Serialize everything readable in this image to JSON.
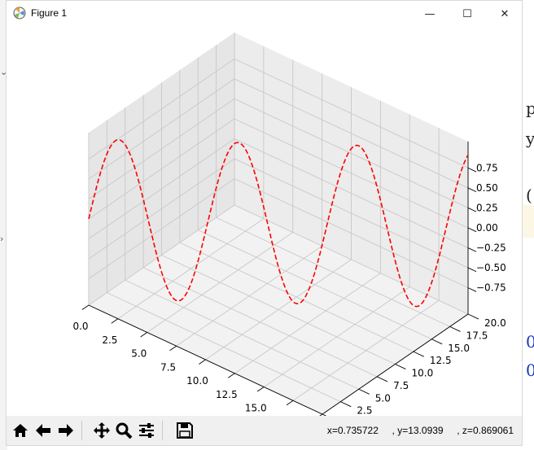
{
  "window": {
    "title": "Figure 1",
    "minimize_glyph": "—",
    "maximize_glyph": "☐",
    "close_glyph": "✕"
  },
  "toolbar": {
    "buttons": [
      {
        "name": "home-icon",
        "glyph": "⌂"
      },
      {
        "name": "back-icon",
        "glyph": "←"
      },
      {
        "name": "forward-icon",
        "glyph": "→"
      },
      {
        "name": "pan-icon",
        "glyph": "✥"
      },
      {
        "name": "zoom-icon",
        "glyph": "🔍"
      },
      {
        "name": "configure-subplots-icon",
        "glyph": "☰"
      },
      {
        "name": "save-icon",
        "glyph": "💾"
      }
    ],
    "coordinates": "x=0.735722     , y=13.0939     , z=0.869061"
  },
  "chart_data": {
    "type": "line",
    "projection": "3d",
    "series": [
      {
        "style": "dashed",
        "color": "#ff0000",
        "function": "z = sin(x), y = x",
        "x_range": [
          0,
          20
        ],
        "y_range": [
          0,
          20
        ]
      }
    ],
    "x_ticks": [
      "0.0",
      "2.5",
      "5.0",
      "7.5",
      "10.0",
      "12.5",
      "15.0",
      "17.5",
      "20.0"
    ],
    "y_ticks": [
      "0.0",
      "2.5",
      "5.0",
      "7.5",
      "10.0",
      "12.5",
      "15.0",
      "17.5",
      "20.0"
    ],
    "z_ticks": [
      "0.75",
      "0.50",
      "0.25",
      "0.00",
      "−0.25",
      "−0.50",
      "−0.75"
    ],
    "xlim": [
      0,
      20
    ],
    "ylim": [
      0,
      20
    ],
    "zlim": [
      -1,
      1
    ],
    "grid": true
  },
  "background": {
    "right_fragments": [
      "p",
      "y",
      "(",
      "0",
      "0"
    ]
  }
}
